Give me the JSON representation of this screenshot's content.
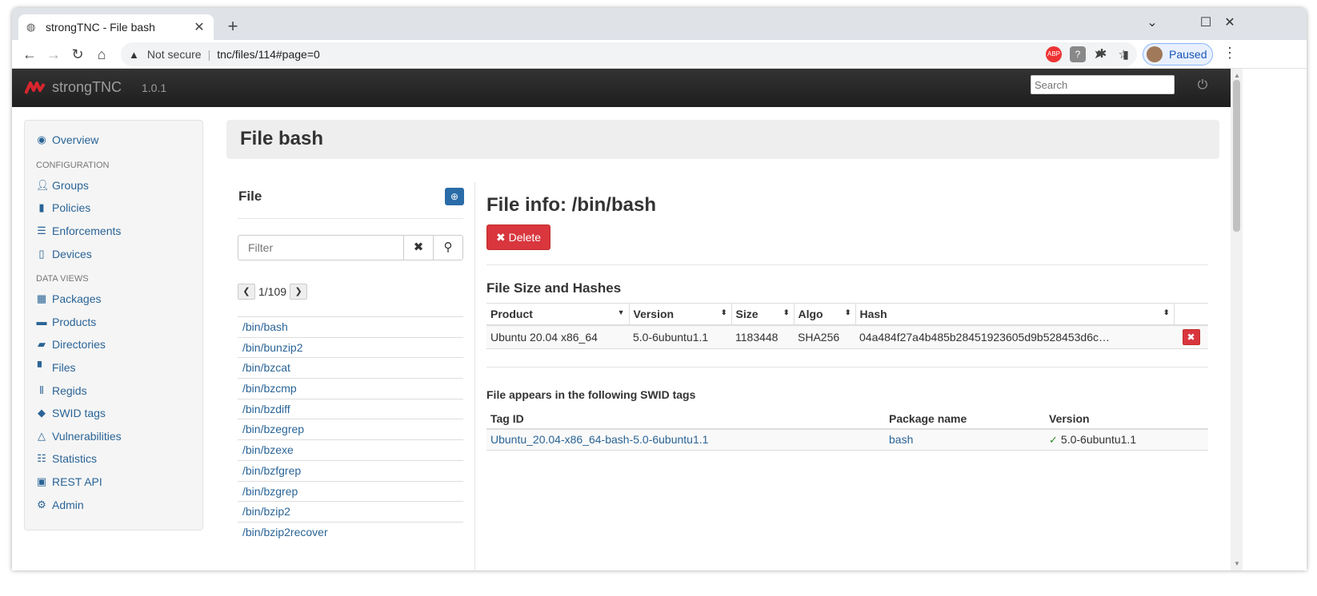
{
  "browser": {
    "tab_title": "strongTNC - File bash",
    "security_label": "Not secure",
    "url": "tnc/files/114#page=0",
    "profile_label": "Paused"
  },
  "navbar": {
    "brand": "strongTNC",
    "version": "1.0.1",
    "search_placeholder": "Search"
  },
  "sidebar": {
    "overview": "Overview",
    "config_header": "CONFIGURATION",
    "config_items": [
      {
        "label": "Groups",
        "icon": "user-icon"
      },
      {
        "label": "Policies",
        "icon": "book-icon"
      },
      {
        "label": "Enforcements",
        "icon": "list-icon"
      },
      {
        "label": "Devices",
        "icon": "phone-icon"
      }
    ],
    "data_header": "DATA VIEWS",
    "data_items": [
      {
        "label": "Packages",
        "icon": "th-large-icon"
      },
      {
        "label": "Products",
        "icon": "briefcase-icon"
      },
      {
        "label": "Directories",
        "icon": "folder-open-icon"
      },
      {
        "label": "Files",
        "icon": "file-icon"
      },
      {
        "label": "Regids",
        "icon": "barcode-icon"
      },
      {
        "label": "SWID tags",
        "icon": "tag-icon"
      },
      {
        "label": "Vulnerabilities",
        "icon": "warning-icon"
      },
      {
        "label": "Statistics",
        "icon": "tasks-icon"
      },
      {
        "label": "REST API",
        "icon": "api-icon"
      },
      {
        "label": "Admin",
        "icon": "cog-icon"
      }
    ]
  },
  "page": {
    "title": "File bash"
  },
  "file_panel": {
    "heading": "File",
    "filter_placeholder": "Filter",
    "pager": "1/109",
    "files": [
      "/bin/bash",
      "/bin/bunzip2",
      "/bin/bzcat",
      "/bin/bzcmp",
      "/bin/bzdiff",
      "/bin/bzegrep",
      "/bin/bzexe",
      "/bin/bzfgrep",
      "/bin/bzgrep",
      "/bin/bzip2",
      "/bin/bzip2recover"
    ]
  },
  "detail": {
    "title": "File info: /bin/bash",
    "delete_label": "Delete",
    "hashes_heading": "File Size and Hashes",
    "hash_columns": [
      "Product",
      "Version",
      "Size",
      "Algo",
      "Hash"
    ],
    "hash_row": {
      "product": "Ubuntu 20.04 x86_64",
      "version": "5.0-6ubuntu1.1",
      "size": "1183448",
      "algo": "SHA256",
      "hash": "04a484f27a4b485b28451923605d9b528453d6c…"
    },
    "swid_heading": "File appears in the following SWID tags",
    "swid_columns": [
      "Tag ID",
      "Package name",
      "Version"
    ],
    "swid_row": {
      "tag_id": "Ubuntu_20.04-x86_64-bash-5.0-6ubuntu1.1",
      "package": "bash",
      "version": "5.0-6ubuntu1.1"
    }
  },
  "colors": {
    "link": "#2a6496",
    "danger": "#d9363e",
    "navbar": "#222222",
    "primary": "#2a6ca8"
  }
}
